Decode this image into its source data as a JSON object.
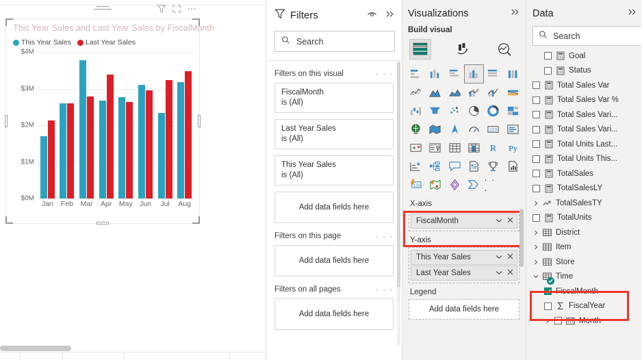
{
  "canvas": {
    "visual": {
      "title": "This Year Sales and Last Year Sales by FiscalMonth",
      "toolbar": {
        "filter_icon": "filter-icon",
        "focus_icon": "focus-mode-icon",
        "more_icon": "more-options-icon",
        "drag_icon": "drag-handle-icon"
      }
    }
  },
  "chart_data": {
    "type": "bar",
    "title": "This Year Sales and Last Year Sales by FiscalMonth",
    "xlabel": "FiscalMonth",
    "ylabel": "",
    "categories": [
      "Jan",
      "Feb",
      "Mar",
      "Apr",
      "May",
      "Jun",
      "Jul",
      "Aug"
    ],
    "series": [
      {
        "name": "This Year Sales",
        "color": "#2ba3c0",
        "values": [
          1700000,
          2600000,
          3770000,
          2680000,
          2770000,
          3100000,
          2330000,
          3180000
        ]
      },
      {
        "name": "Last Year Sales",
        "color": "#dc1f26",
        "values": [
          2140000,
          2600000,
          2790000,
          3390000,
          2640000,
          2950000,
          3230000,
          3470000
        ]
      }
    ],
    "ylim": [
      0,
      4000000
    ],
    "ytick_labels": [
      "$4M",
      "$3M",
      "$2M",
      "$1M",
      "$0M"
    ],
    "ytick_values": [
      4000000,
      3000000,
      2000000,
      1000000,
      0
    ],
    "grid": true,
    "legend_position": "top-left"
  },
  "filters": {
    "title": "Filters",
    "eye_icon": "eye-icon",
    "collapse_icon": "double-chevron-right-icon",
    "search": {
      "placeholder": "Search",
      "icon": "search-icon",
      "value": ""
    },
    "sections": [
      {
        "title": "Filters on this visual",
        "more": "· · ·",
        "cards": [
          {
            "field": "FiscalMonth",
            "state": "is (All)"
          },
          {
            "field": "Last Year Sales",
            "state": "is (All)"
          },
          {
            "field": "This Year Sales",
            "state": "is (All)"
          }
        ],
        "drop_label": "Add data fields here"
      },
      {
        "title": "Filters on this page",
        "more": "· · ·",
        "cards": [],
        "drop_label": "Add data fields here"
      },
      {
        "title": "Filters on all pages",
        "more": "· · ·",
        "cards": [],
        "drop_label": "Add data fields here"
      }
    ]
  },
  "visualizations": {
    "title": "Visualizations",
    "collapse_icon": "double-chevron-right-icon",
    "build_label": "Build visual",
    "top_icons": [
      {
        "name": "build-visual-icon",
        "selected": true
      },
      {
        "name": "format-visual-icon",
        "selected": false
      },
      {
        "name": "analytics-icon",
        "selected": false
      }
    ],
    "chart_types": [
      "stacked-bar-chart-icon",
      "stacked-column-chart-icon",
      "clustered-bar-chart-icon",
      "clustered-column-chart-icon",
      "100-stacked-bar-chart-icon",
      "100-stacked-column-chart-icon",
      "line-chart-icon",
      "area-chart-icon",
      "stacked-area-chart-icon",
      "line-stacked-column-chart-icon",
      "line-clustered-column-chart-icon",
      "ribbon-chart-icon",
      "waterfall-chart-icon",
      "funnel-chart-icon",
      "scatter-chart-icon",
      "pie-chart-icon",
      "donut-chart-icon",
      "treemap-icon",
      "map-icon",
      "filled-map-icon",
      "azure-map-icon",
      "gauge-icon",
      "card-icon",
      "multi-row-card-icon",
      "kpi-icon",
      "slicer-icon",
      "table-icon",
      "matrix-icon",
      "r-script-visual-icon",
      "python-visual-icon",
      "key-influencers-icon",
      "decomposition-tree-icon",
      "qna-icon",
      "smart-narrative-icon",
      "metrics-icon",
      "paginated-report-icon",
      "power-apps-icon",
      "arcgis-map-icon",
      "power-automate-icon",
      "synapse-icon",
      "more-visuals-icon"
    ],
    "selected_chart_type_index": 3,
    "wells": [
      {
        "label": "X-axis",
        "highlighted": true,
        "fields": [
          {
            "name": "FiscalMonth",
            "chevron": "chevron-down-icon",
            "remove": "remove-field-icon"
          }
        ],
        "empty_label": ""
      },
      {
        "label": "Y-axis",
        "highlighted": false,
        "fields": [
          {
            "name": "This Year Sales",
            "chevron": "chevron-down-icon",
            "remove": "remove-field-icon"
          },
          {
            "name": "Last Year Sales",
            "chevron": "chevron-down-icon",
            "remove": "remove-field-icon"
          }
        ],
        "empty_label": ""
      },
      {
        "label": "Legend",
        "highlighted": false,
        "fields": [],
        "empty_label": "Add data fields here"
      }
    ]
  },
  "data_pane": {
    "title": "Data",
    "collapse_icon": "double-chevron-right-icon",
    "search": {
      "placeholder": "Search",
      "icon": "search-icon",
      "value": ""
    },
    "fields": [
      {
        "label": "Goal",
        "type": "measure",
        "indent": 2,
        "checked": false,
        "expandable": false,
        "partial": true
      },
      {
        "label": "Status",
        "type": "measure",
        "indent": 2,
        "checked": false,
        "expandable": false
      },
      {
        "label": "Total Sales Var",
        "type": "measure",
        "indent": 1,
        "checked": false,
        "expandable": false
      },
      {
        "label": "Total Sales Var %",
        "type": "measure",
        "indent": 1,
        "checked": false,
        "expandable": false
      },
      {
        "label": "Total Sales Vari...",
        "type": "measure",
        "indent": 1,
        "checked": false,
        "expandable": false
      },
      {
        "label": "Total Sales Vari...",
        "type": "measure",
        "indent": 1,
        "checked": false,
        "expandable": false
      },
      {
        "label": "Total Units Last...",
        "type": "measure",
        "indent": 1,
        "checked": false,
        "expandable": false
      },
      {
        "label": "Total Units This...",
        "type": "measure",
        "indent": 1,
        "checked": false,
        "expandable": false
      },
      {
        "label": "TotalSales",
        "type": "measure",
        "indent": 1,
        "checked": false,
        "expandable": false
      },
      {
        "label": "TotalSalesLY",
        "type": "measure",
        "indent": 1,
        "checked": false,
        "expandable": false
      },
      {
        "label": "TotalSalesTY",
        "type": "quick-measure",
        "indent": 1,
        "checked": false,
        "expandable": true
      },
      {
        "label": "TotalUnits",
        "type": "measure",
        "indent": 1,
        "checked": false,
        "expandable": false
      },
      {
        "label": "District",
        "type": "table",
        "indent": 0,
        "checked": false,
        "expandable": true
      },
      {
        "label": "Item",
        "type": "table",
        "indent": 0,
        "checked": false,
        "expandable": true
      },
      {
        "label": "Store",
        "type": "table",
        "indent": 0,
        "checked": false,
        "expandable": true
      },
      {
        "label": "Time",
        "type": "table-active",
        "indent": 0,
        "checked": false,
        "expandable": true,
        "expanded": true,
        "highlighted": true
      },
      {
        "label": "FiscalMonth",
        "type": "column",
        "indent": 2,
        "checked": true,
        "expandable": false,
        "highlighted": true
      },
      {
        "label": "FiscalYear",
        "type": "sum-column",
        "indent": 2,
        "checked": false,
        "expandable": false
      },
      {
        "label": "Month",
        "type": "date-hierarchy",
        "indent": 2,
        "checked": false,
        "expandable": true
      }
    ]
  }
}
